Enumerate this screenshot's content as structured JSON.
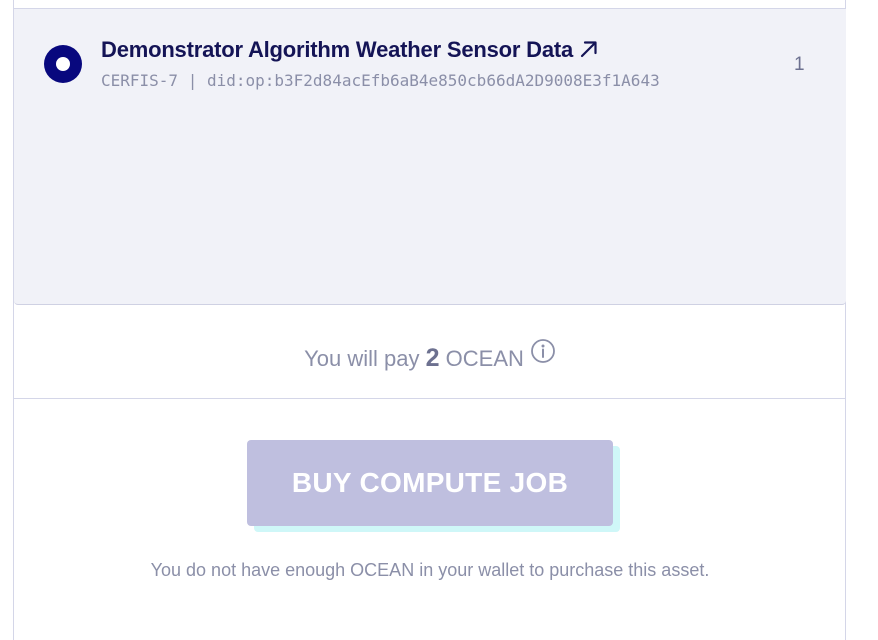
{
  "asset_list": {
    "items": [
      {
        "title": "Demonstrator Algorithm Weather Sensor Data",
        "meta": "CERFIS-7 | did:op:b3F2d84acEfb6aB4e850cb66dA2D9008E3f1A643",
        "count": "1",
        "selected": true,
        "link_icon": "external-link-icon"
      }
    ]
  },
  "payment": {
    "prefix": "You will pay",
    "amount": "2",
    "currency": "OCEAN",
    "info_icon": "info-icon"
  },
  "buy_button": {
    "label": "BUY COMPUTE JOB",
    "disabled": true
  },
  "warning_text": "You do not have enough OCEAN in your wallet to purchase this asset.",
  "colors": {
    "primary": "#08087e",
    "title": "#141456",
    "muted": "#8b8fa8",
    "list_bg": "#f1f2f8",
    "button_disabled": "#bfbfdf",
    "button_shadow": "#cff7f8"
  }
}
